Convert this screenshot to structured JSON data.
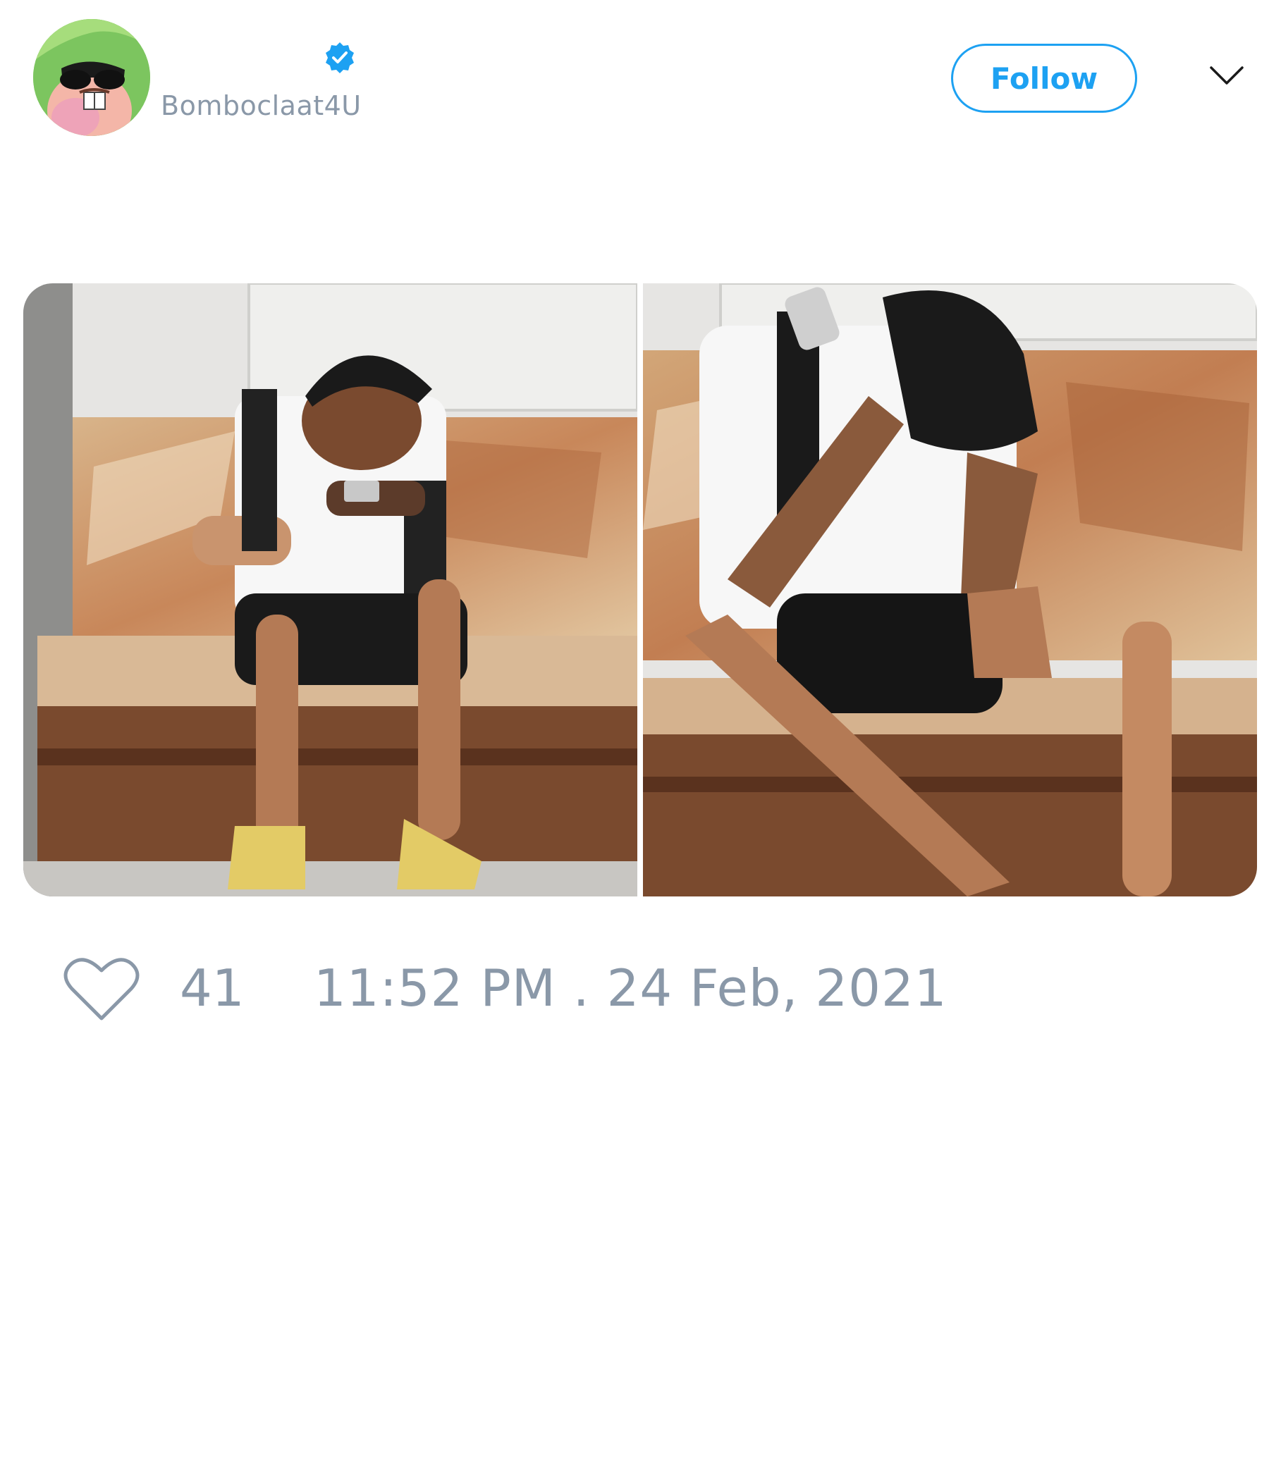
{
  "user": {
    "display_name": "",
    "username": "Bomboclaat4U",
    "verified": true,
    "avatar_icon": "cartoon-face-with-sunglasses"
  },
  "header": {
    "follow_label": "Follow",
    "menu_icon": "chevron-down-icon"
  },
  "media": {
    "photos": [
      {
        "name": "man-laughing-at-phone"
      },
      {
        "name": "man-facepalming-with-phone"
      }
    ]
  },
  "footer": {
    "like_icon": "heart-outline-icon",
    "likes_count": "41",
    "timestamp": "11:52 PM . 24 Feb, 2021"
  },
  "colors": {
    "accent": "#1da1f2",
    "muted_text": "#8a98a8",
    "background": "#ffffff"
  }
}
